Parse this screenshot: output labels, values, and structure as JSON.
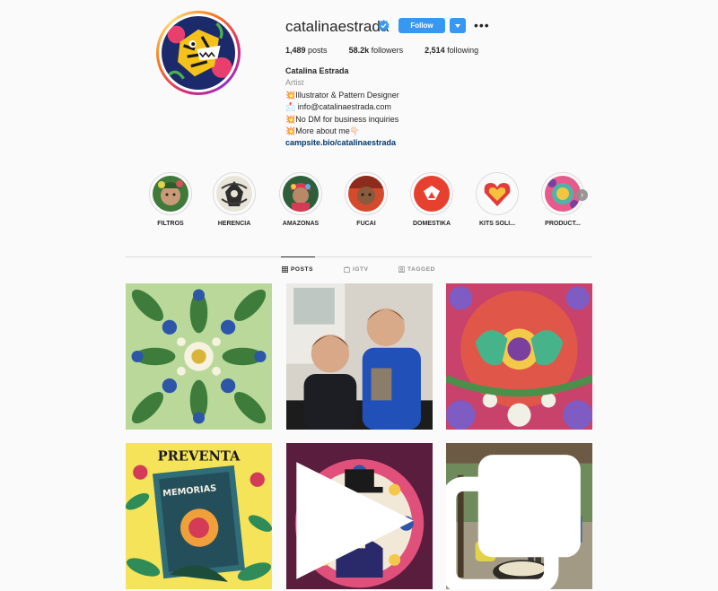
{
  "profile": {
    "username": "catalinaestrada",
    "verified": true,
    "follow_label": "Follow",
    "stats": {
      "posts": "1,489",
      "posts_label": "posts",
      "followers": "58.2k",
      "followers_label": "followers",
      "following": "2,514",
      "following_label": "following"
    },
    "full_name": "Catalina Estrada",
    "category": "Artist",
    "bio_lines": [
      "💥Illustrator & Pattern Designer",
      "📩 info@catalinaestrada.com",
      "💥No DM for business inquiries",
      "💥More about me👇🏻"
    ],
    "link": "campsite.bio/catalinaestrada"
  },
  "highlights": [
    {
      "label": "FILTROS"
    },
    {
      "label": "HERENCIA"
    },
    {
      "label": "AMAZONAS"
    },
    {
      "label": "FUCAI"
    },
    {
      "label": "DOMESTIKA"
    },
    {
      "label": "KITS SOLI..."
    },
    {
      "label": "PRODUCT..."
    }
  ],
  "tabs": [
    {
      "label": "POSTS",
      "icon": "grid-icon",
      "active": true
    },
    {
      "label": "IGTV",
      "icon": "igtv-icon",
      "active": false
    },
    {
      "label": "TAGGED",
      "icon": "tag-icon",
      "active": false
    }
  ],
  "posts": [
    {
      "name": "post-floral-kaleidoscope"
    },
    {
      "name": "post-kids-photo"
    },
    {
      "name": "post-tigers-pattern"
    },
    {
      "name": "post-preventa-book",
      "overlay_text": "PREVENTA",
      "book_title": "MEMORIAS"
    },
    {
      "name": "post-girl-illustration",
      "badge": "video-icon"
    },
    {
      "name": "post-cooking-photo",
      "badge": "carousel-icon"
    }
  ],
  "colors": {
    "accent": "#3897f0",
    "text": "#262626",
    "muted": "#8e8e8e",
    "link": "#00376b",
    "background": "#fafafa"
  }
}
